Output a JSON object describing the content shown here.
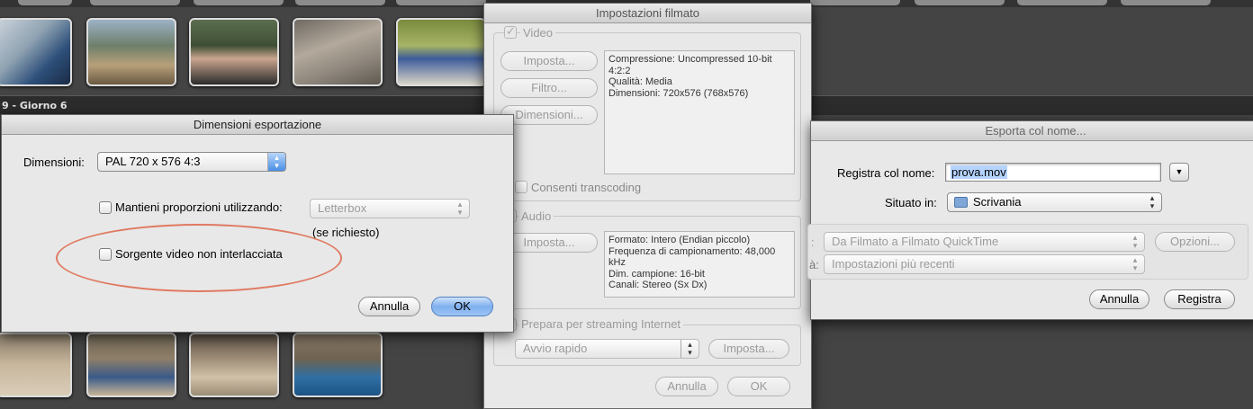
{
  "background": {
    "section_label": "9 - Giorno 6",
    "top_thumbnails": [
      "clip-boy-basketball",
      "clip-boys-bridge",
      "clip-woman-trees",
      "clip-ground-stones",
      "clip-boys-playground"
    ],
    "bottom_thumbnails": [
      "clip-beach-cove",
      "clip-picnic-rocks",
      "clip-people-beach",
      "clip-sea-rocks"
    ]
  },
  "export_dims": {
    "title": "Dimensioni esportazione",
    "dimensions_label": "Dimensioni:",
    "dimensions_value": "PAL 720 x 576 4:3",
    "keep_ratio_label": "Mantieni proporzioni utilizzando:",
    "keep_ratio_value": "Letterbox",
    "if_needed": "(se richiesto)",
    "non_interlaced_label": "Sorgente video non interlacciata",
    "cancel": "Annulla",
    "ok": "OK"
  },
  "movie_settings": {
    "title": "Impostazioni filmato",
    "video_label": "Video",
    "settings_btn": "Imposta...",
    "filter_btn": "Filtro...",
    "size_btn": "Dimensioni...",
    "video_info": [
      "Compressione: Uncompressed 10-bit 4:2:2",
      "Qualità: Media",
      "Dimensioni: 720x576 (768x576)"
    ],
    "transcoding_label": "Consenti transcoding",
    "audio_label": "Audio",
    "audio_settings_btn": "Imposta...",
    "audio_info": [
      "Formato: Intero (Endian piccolo)",
      "Frequenza di campionamento: 48,000 kHz",
      "Dim. campione: 16-bit",
      "Canali: Stereo (Sx Dx)"
    ],
    "streaming_label": "Prepara per streaming Internet",
    "streaming_value": "Avvio rapido",
    "streaming_settings_btn": "Imposta...",
    "cancel": "Annulla",
    "ok": "OK"
  },
  "save_as": {
    "title": "Esporta col nome...",
    "save_as_label": "Registra col nome:",
    "filename": "prova.mov",
    "where_label": "Situato in:",
    "where_value": "Scrivania",
    "export_label": ":",
    "export_value": "Da Filmato a Filmato QuickTime",
    "options_btn": "Opzioni...",
    "use_label": "à:",
    "use_value": "Impostazioni più recenti",
    "cancel": "Annulla",
    "save": "Registra"
  }
}
